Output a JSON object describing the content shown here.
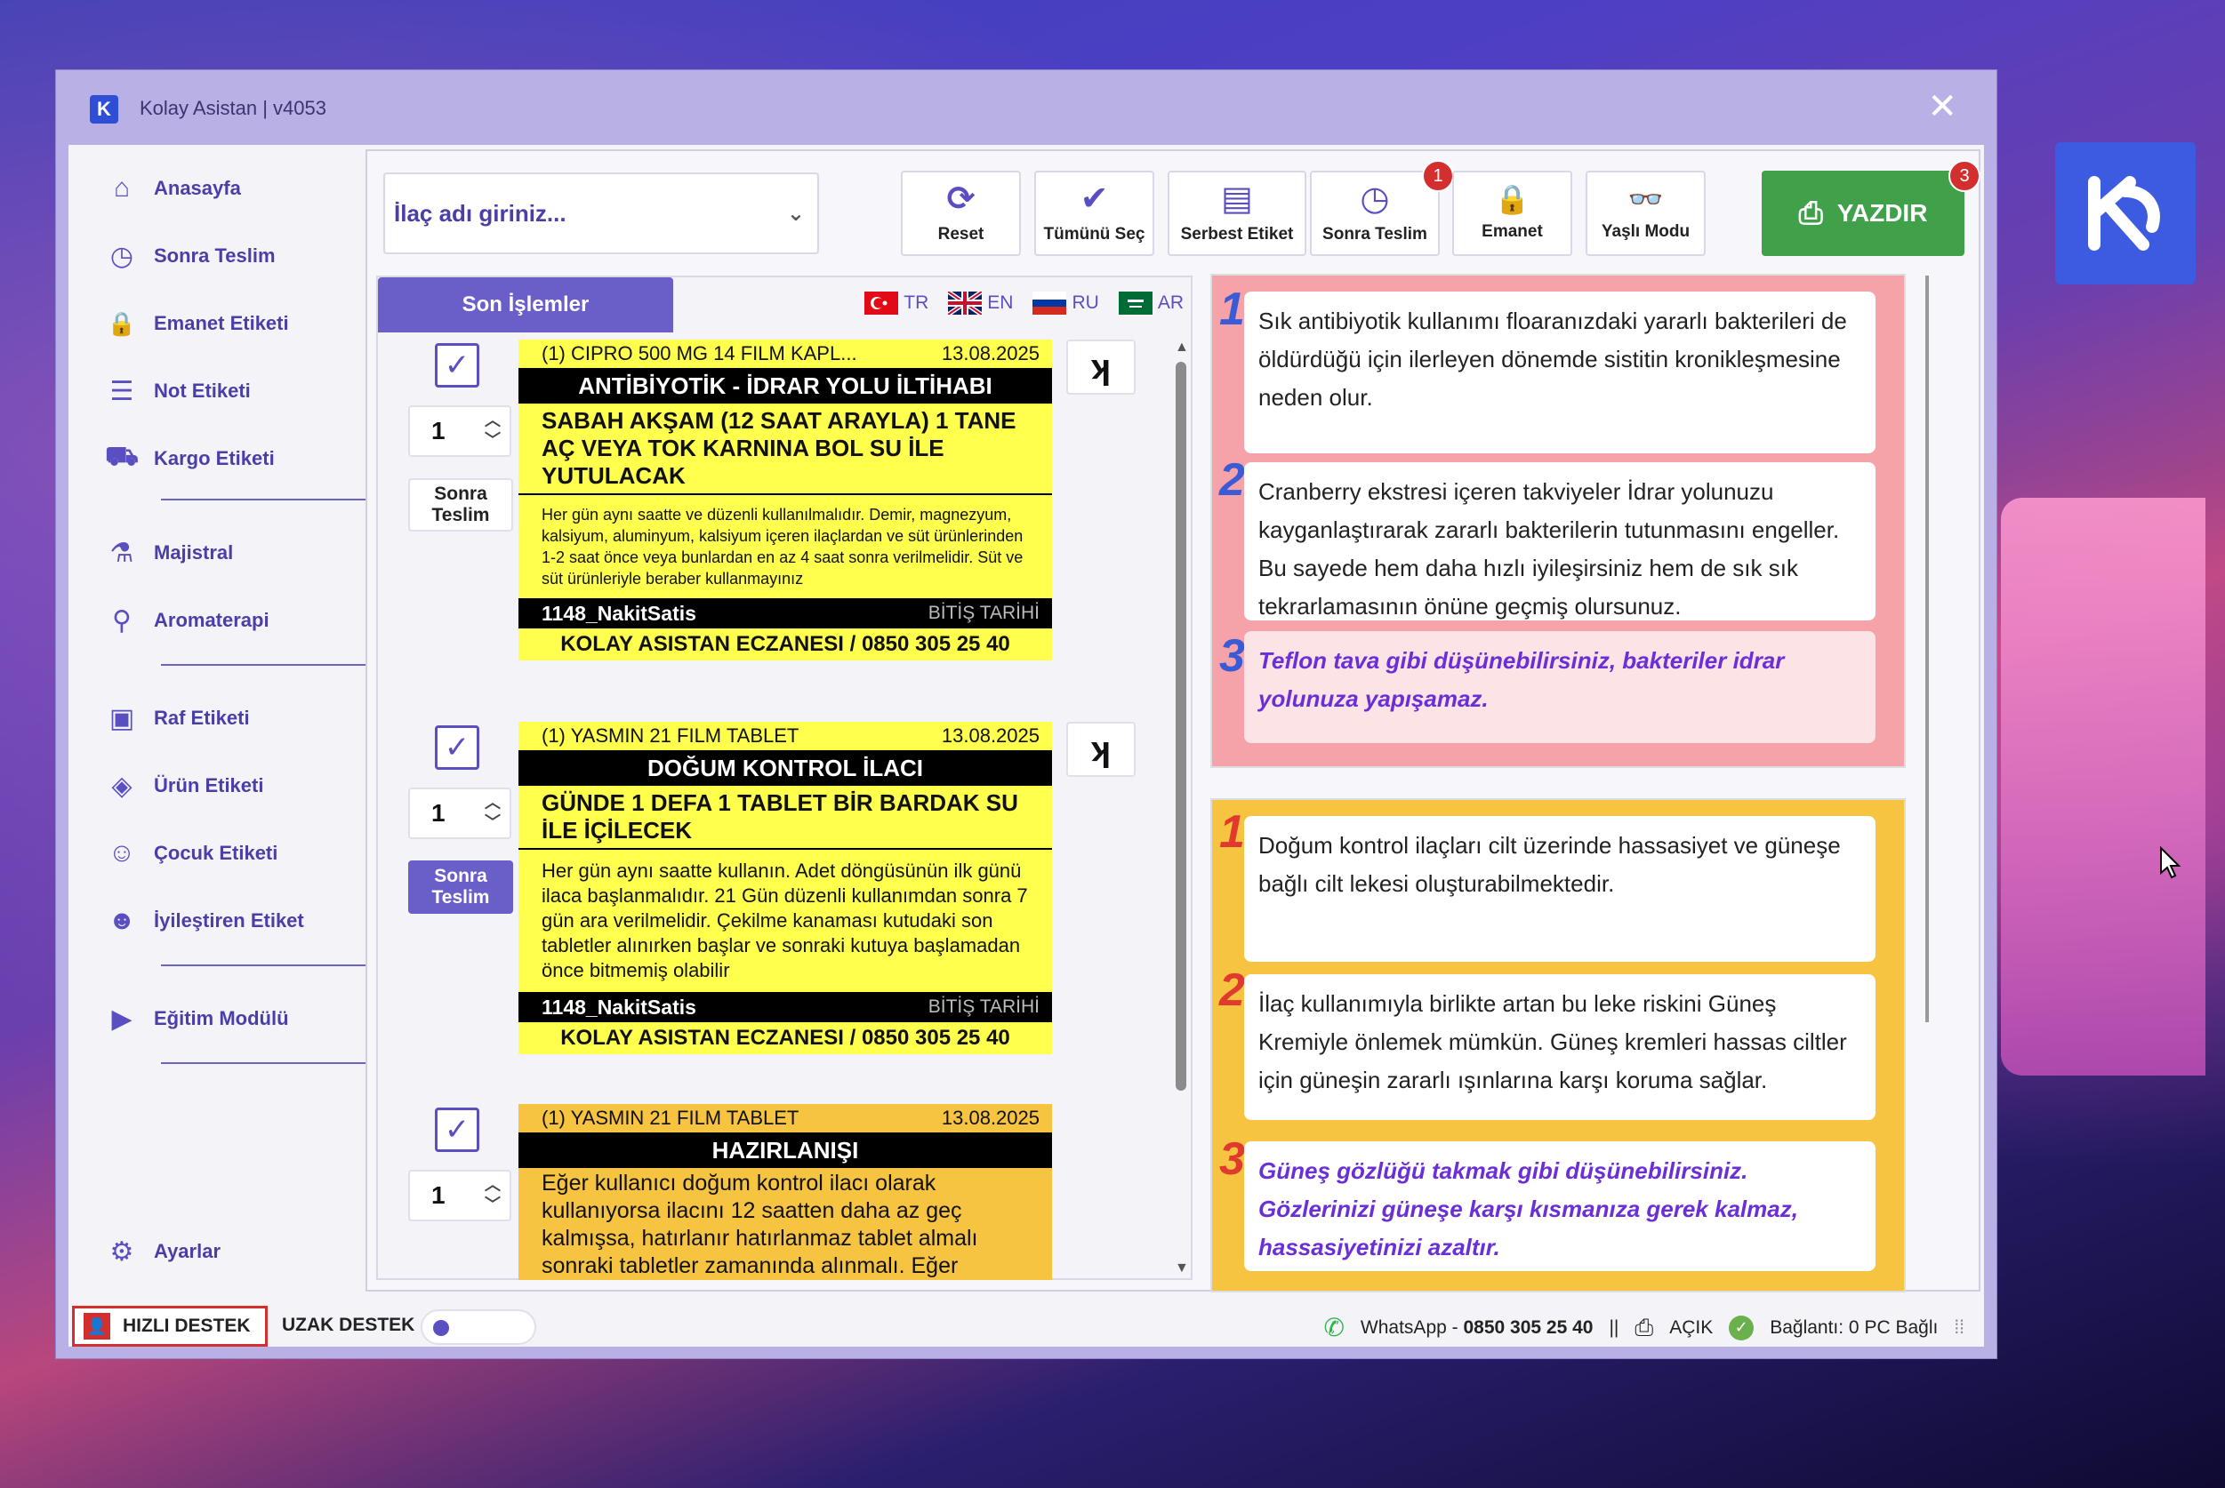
{
  "window": {
    "title": "Kolay Asistan | v4053",
    "app_icon": "K",
    "close": "✕"
  },
  "sidebar": {
    "items": [
      {
        "label": "Anasayfa",
        "icon": "home-icon",
        "glyph": "⌂"
      },
      {
        "label": "Sonra Teslim",
        "icon": "clock-icon",
        "glyph": "◷"
      },
      {
        "label": "Emanet Etiketi",
        "icon": "lock-icon",
        "glyph": "🔒"
      },
      {
        "label": "Not Etiketi",
        "icon": "note-icon",
        "glyph": "☰"
      },
      {
        "label": "Kargo Etiketi",
        "icon": "package-icon",
        "glyph": "⛟"
      },
      {
        "label": "Majistral",
        "icon": "flask-icon",
        "glyph": "⚗"
      },
      {
        "label": "Aromaterapi",
        "icon": "dropper-icon",
        "glyph": "⚲"
      },
      {
        "label": "Raf Etiketi",
        "icon": "shelf-icon",
        "glyph": "▣"
      },
      {
        "label": "Ürün Etiketi",
        "icon": "cube-icon",
        "glyph": "◈"
      },
      {
        "label": "Çocuk Etiketi",
        "icon": "child-icon",
        "glyph": "☺"
      },
      {
        "label": "İyileştiren Etiket",
        "icon": "smile-icon",
        "glyph": "☻"
      },
      {
        "label": "Eğitim Modülü",
        "icon": "play-icon",
        "glyph": "▶"
      }
    ],
    "settings_label": "Ayarlar"
  },
  "search": {
    "placeholder": "İlaç adı giriniz..."
  },
  "toolbar": {
    "buttons": [
      {
        "label": "Reset",
        "icon": "refresh-icon",
        "glyph": "⟳"
      },
      {
        "label": "Tümünü Seç",
        "icon": "check-all-icon",
        "glyph": "✔"
      },
      {
        "label": "Serbest Etiket",
        "icon": "document-icon",
        "glyph": "▤"
      },
      {
        "label": "Sonra Teslim",
        "icon": "clock-icon",
        "glyph": "◷",
        "badge": "1"
      },
      {
        "label": "Emanet",
        "icon": "lock-icon",
        "glyph": "🔒"
      },
      {
        "label": "Yaşlı Modu",
        "icon": "glasses-icon",
        "glyph": "👓"
      }
    ],
    "print_label": "YAZDIR",
    "print_badge": "3"
  },
  "recent": {
    "tab_label": "Son İşlemler",
    "languages": [
      "TR",
      "EN",
      "RU",
      "AR"
    ],
    "entries": [
      {
        "qty": "1",
        "later_label_1": "Sonra",
        "later_label_2": "Teslim",
        "drug": "(1) CIPRO 500 MG 14 FILM KAPL...",
        "date": "13.08.2025",
        "category": "ANTİBİYOTİK - İDRAR YOLU İLTİHABI",
        "dose": "SABAH AKŞAM (12 SAAT ARAYLA) 1 TANE AÇ VEYA TOK KARNINA BOL SU İLE YUTULACAK",
        "desc": "Her gün aynı saatte ve düzenli kullanılmalıdır. Demir, magnezyum, kalsiyum, aluminyum, kalsiyum içeren ilaçlardan ve süt ürünlerinden 1-2 saat önce veya bunlardan en az 4 saat sonra verilmelidir. Süt ve süt ürünleriyle beraber kullanmayınız",
        "user": "1148_NakitSatis",
        "expiry": "BİTİŞ TARİHİ",
        "pharmacy": "KOLAY ASISTAN ECZANESI / 0850 305 25 40"
      },
      {
        "qty": "1",
        "later_label_1": "Sonra",
        "later_label_2": "Teslim",
        "drug": "(1) YASMIN 21 FILM TABLET",
        "date": "13.08.2025",
        "category": "DOĞUM KONTROL İLACI",
        "dose": "GÜNDE 1 DEFA 1 TABLET BİR BARDAK SU İLE İÇİLECEK",
        "desc": "Her gün aynı saatte kullanın. Adet döngüsünün ilk günü ilaca başlanmalıdır. 21 Gün düzenli kullanımdan sonra 7 gün ara verilmelidir. Çekilme kanaması kutudaki son tabletler alınırken başlar ve sonraki kutuya başlamadan önce bitmemiş olabilir",
        "user": "1148_NakitSatis",
        "expiry": "BİTİŞ TARİHİ",
        "pharmacy": "KOLAY ASISTAN ECZANESI / 0850 305 25 40"
      },
      {
        "qty": "1",
        "drug": "(1) YASMIN 21 FILM TABLET",
        "date": "13.08.2025",
        "category": "HAZIRLANIŞI",
        "desc": "Eğer kullanıcı doğum kontrol ilacı olarak kullanıyorsa ilacını 12 saatten daha az geç kalmışsa, hatırlanır hatırlanmaz tablet almalı sonraki tabletler zamanında alınmalı. Eğer"
      }
    ]
  },
  "info_panels": {
    "antibiotic": [
      {
        "n": "1",
        "text": "Sık antibiyotik kullanımı floaranızdaki yararlı bakterileri de öldürdüğü için ilerleyen dönemde sistitin kronikleşmesine neden olur."
      },
      {
        "n": "2",
        "text": "Cranberry ekstresi içeren takviyeler İdrar yolunuzu kayganlaştırarak zararlı bakterilerin tutunmasını engeller. Bu sayede hem daha hızlı iyileşirsiniz hem de sık sık tekrarlamasının önüne geçmiş olursunuz."
      },
      {
        "n": "3",
        "text": "Teflon tava gibi düşünebilirsiniz, bakteriler idrar yolunuza yapışamaz."
      }
    ],
    "contraceptive": [
      {
        "n": "1",
        "text": "Doğum kontrol ilaçları cilt üzerinde hassasiyet ve güneşe bağlı cilt lekesi oluşturabilmektedir."
      },
      {
        "n": "2",
        "text": "İlaç kullanımıyla birlikte artan bu leke riskini Güneş Kremiyle önlemek mümkün. Güneş kremleri hassas ciltler için güneşin zararlı ışınlarına karşı koruma sağlar."
      },
      {
        "n": "3",
        "text": "Güneş gözlüğü takmak gibi düşünebilirsiniz. Gözlerinizi güneşe karşı kısmanıza gerek kalmaz, hassasiyetinizi azaltır."
      }
    ]
  },
  "status": {
    "quick_support": "HIZLI DESTEK",
    "remote_support": "UZAK DESTEK",
    "whatsapp": "WhatsApp - ",
    "whatsapp_number": "0850 305 25 40",
    "sep": "||",
    "printer": "AÇIK",
    "connection": "Bağlantı: 0 PC Bağlı"
  }
}
